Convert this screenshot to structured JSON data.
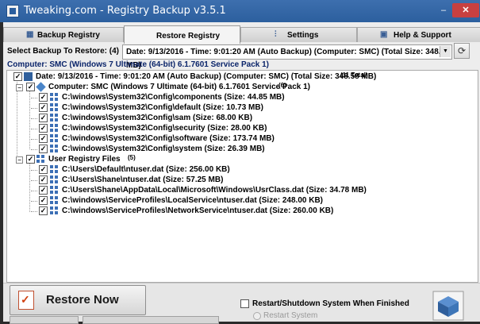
{
  "window": {
    "title": "Tweaking.com - Registry Backup v3.5.1",
    "minimize": "–",
    "close": "✕"
  },
  "tabs": [
    {
      "label": "Backup Registry",
      "icon": "registry-icon"
    },
    {
      "label": "Restore Registry",
      "icon": ""
    },
    {
      "label": "Settings",
      "icon": "settings-sliders-icon"
    },
    {
      "label": "Help & Support",
      "icon": "help-book-icon"
    }
  ],
  "select": {
    "label": "Select Backup To Restore: (4)",
    "value": "Date: 9/13/2016 - Time: 9:01:20 AM (Auto Backup) (Computer: SMC) (Total Size: 348.58 MB)"
  },
  "computer_bar": "Computer: SMC (Windows 7 Ultimate (64-bit) 6.1.7601 Service Pack 1)",
  "tree": {
    "root": {
      "label": "Date: 9/13/2016 - Time: 9:01:20 AM (Auto Backup) (Computer: SMC) (Total Size: 348.58 MB)",
      "count": "(11 Total)"
    },
    "computer_node": {
      "label": "Computer: SMC (Windows 7 Ultimate (64-bit) 6.1.7601 Service Pack 1)",
      "count": "(6)"
    },
    "system_files": [
      "C:\\windows\\System32\\Config\\components (Size: 44.85 MB)",
      "C:\\windows\\System32\\Config\\default (Size: 10.73 MB)",
      "C:\\windows\\System32\\Config\\sam (Size: 68.00 KB)",
      "C:\\windows\\System32\\Config\\security (Size: 28.00 KB)",
      "C:\\windows\\System32\\Config\\software (Size: 173.74 MB)",
      "C:\\windows\\System32\\Config\\system (Size: 26.39 MB)"
    ],
    "user_node": {
      "label": "User Registry Files",
      "count": "(5)"
    },
    "user_files": [
      "C:\\Users\\Default\\ntuser.dat (Size: 256.00 KB)",
      "C:\\Users\\Shane\\ntuser.dat (Size: 57.25 MB)",
      "C:\\Users\\Shane\\AppData\\Local\\Microsoft\\Windows\\UsrClass.dat (Size: 34.78 MB)",
      "C:\\windows\\ServiceProfiles\\LocalService\\ntuser.dat (Size: 248.00 KB)",
      "C:\\windows\\ServiceProfiles\\NetworkService\\ntuser.dat (Size: 260.00 KB)"
    ]
  },
  "bottom": {
    "restore_label": "Restore Now",
    "restart_label": "Restart/Shutdown System When Finished",
    "restart_option": "Restart System"
  }
}
